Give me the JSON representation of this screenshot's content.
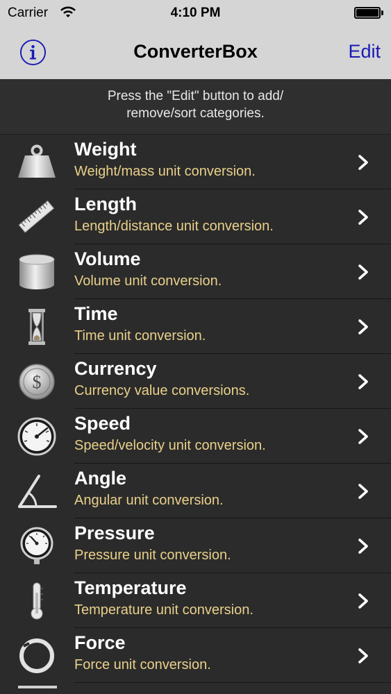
{
  "status": {
    "carrier": "Carrier",
    "time": "4:10 PM"
  },
  "nav": {
    "title": "ConverterBox",
    "edit_label": "Edit",
    "info_icon": "info-icon"
  },
  "hint": {
    "line1": "Press the \"Edit\" button to add/",
    "line2": "remove/sort categories."
  },
  "colors": {
    "title_text": "#ffffff",
    "subtitle_text": "#e9d08a",
    "edit_link": "#1a1ab8"
  },
  "categories": [
    {
      "title": "Weight",
      "subtitle": "Weight/mass unit conversion.",
      "icon": "weight-icon"
    },
    {
      "title": "Length",
      "subtitle": "Length/distance unit conversion.",
      "icon": "ruler-icon"
    },
    {
      "title": "Volume",
      "subtitle": "Volume unit conversion.",
      "icon": "cylinder-icon"
    },
    {
      "title": "Time",
      "subtitle": "Time unit conversion.",
      "icon": "hourglass-icon"
    },
    {
      "title": "Currency",
      "subtitle": "Currency value conversions.",
      "icon": "coin-icon"
    },
    {
      "title": "Speed",
      "subtitle": "Speed/velocity unit conversion.",
      "icon": "speedometer-icon"
    },
    {
      "title": "Angle",
      "subtitle": "Angular unit conversion.",
      "icon": "angle-icon"
    },
    {
      "title": "Pressure",
      "subtitle": "Pressure unit conversion.",
      "icon": "pressure-gauge-icon"
    },
    {
      "title": "Temperature",
      "subtitle": "Temperature unit conversion.",
      "icon": "thermometer-icon"
    },
    {
      "title": "Force",
      "subtitle": "Force unit conversion.",
      "icon": "ring-icon"
    }
  ]
}
